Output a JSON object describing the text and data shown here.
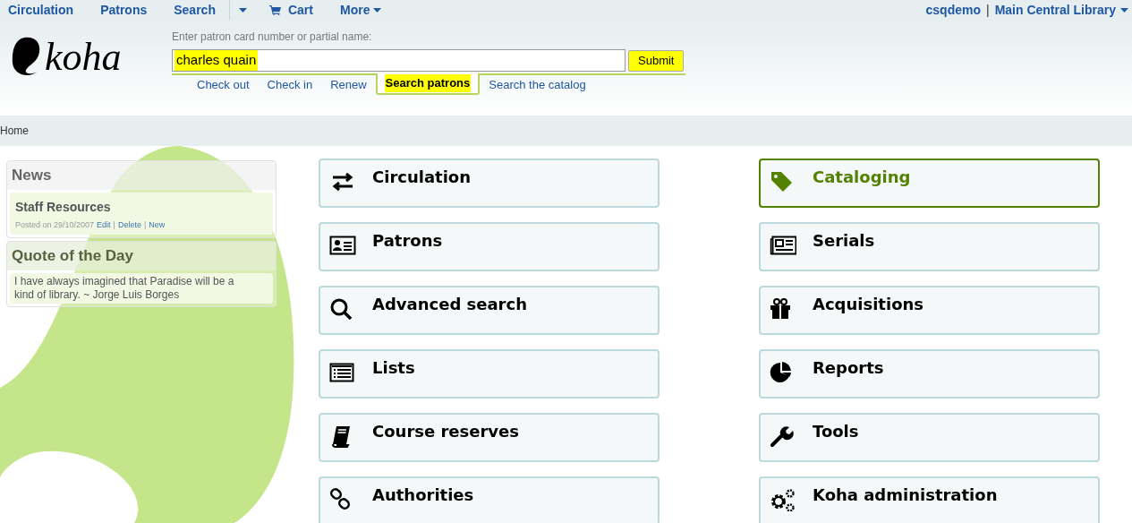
{
  "top_nav": {
    "items": [
      {
        "label": "Circulation",
        "kind": "link"
      },
      {
        "label": "Patrons",
        "kind": "link"
      },
      {
        "label": "Search",
        "kind": "link"
      },
      {
        "kind": "caret"
      },
      {
        "label": "Cart",
        "kind": "cart"
      },
      {
        "label": "More",
        "kind": "menu"
      }
    ],
    "user": "csqdemo",
    "separator": "|",
    "library": "Main Central Library"
  },
  "header": {
    "logo_text": "koha",
    "prompt": "Enter patron card number or partial name:",
    "search_value": "charles quain",
    "search_highlighted": true,
    "submit": {
      "label": "Submit",
      "highlighted": true
    },
    "tabs": [
      {
        "label": "Check out",
        "selected": false,
        "highlighted": false
      },
      {
        "label": "Check in",
        "selected": false,
        "highlighted": false
      },
      {
        "label": "Renew",
        "selected": false,
        "highlighted": false
      },
      {
        "label": "Search patrons",
        "selected": true,
        "highlighted": true
      },
      {
        "label": "Search the catalog",
        "selected": false,
        "highlighted": false
      }
    ]
  },
  "breadcrumb": "Home",
  "news": {
    "title": "News",
    "items": [
      {
        "title": "Staff Resources",
        "posted": "Posted on 29/10/2007",
        "links": [
          "Edit",
          "Delete",
          "New"
        ],
        "link_separators": [
          "|",
          "|"
        ]
      }
    ]
  },
  "quote": {
    "title": "Quote of the Day",
    "text": "I have always imagined that Paradise will be a kind of library. ~ Jorge Luis Borges"
  },
  "modules_left": [
    {
      "label": "Circulation",
      "selected": false
    },
    {
      "label": "Patrons",
      "selected": false
    },
    {
      "label": "Advanced search",
      "selected": false
    },
    {
      "label": "Lists",
      "selected": false
    },
    {
      "label": "Course reserves",
      "selected": false
    },
    {
      "label": "Authorities",
      "selected": false
    }
  ],
  "modules_right": [
    {
      "label": "Cataloging",
      "selected": true
    },
    {
      "label": "Serials",
      "selected": false
    },
    {
      "label": "Acquisitions",
      "selected": false
    },
    {
      "label": "Reports",
      "selected": false
    },
    {
      "label": "Tools",
      "selected": false
    },
    {
      "label": "Koha administration",
      "selected": false
    }
  ]
}
